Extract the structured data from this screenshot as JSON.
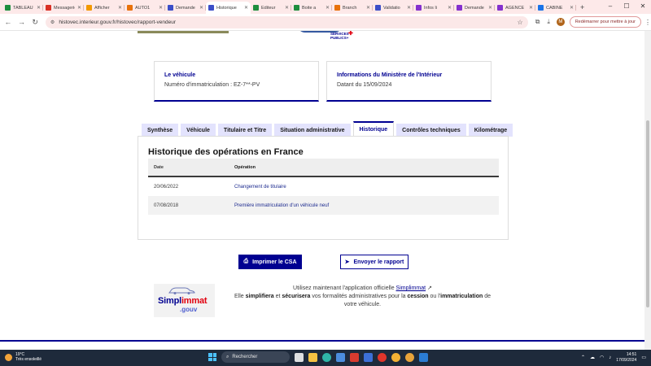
{
  "browser": {
    "tabs": [
      {
        "label": "TABLEAU",
        "color": "#1e8e3e",
        "active": false
      },
      {
        "label": "Messagerie",
        "color": "#d93025",
        "active": false
      },
      {
        "label": "Afficher",
        "color": "#f29900",
        "active": false
      },
      {
        "label": "AUTO1",
        "color": "#e8710a",
        "active": false
      },
      {
        "label": "Demande",
        "color": "#3c4ec8",
        "active": false
      },
      {
        "label": "Historique",
        "color": "#3c4ec8",
        "active": true
      },
      {
        "label": "Editeur",
        "color": "#1e8e3e",
        "active": false
      },
      {
        "label": "Boite a",
        "color": "#1e8e3e",
        "active": false
      },
      {
        "label": "Branch",
        "color": "#e8710a",
        "active": false
      },
      {
        "label": "Validatio",
        "color": "#3c4ec8",
        "active": false
      },
      {
        "label": "Infos li",
        "color": "#8430ce",
        "active": false
      },
      {
        "label": "Demande",
        "color": "#8430ce",
        "active": false
      },
      {
        "label": "AGENCE",
        "color": "#8430ce",
        "active": false
      },
      {
        "label": "CABINE",
        "color": "#1a73e8",
        "active": false
      }
    ],
    "url": "histovec.interieur.gouv.fr/histovec/rapport-vendeur",
    "restart_label": "Redémarrer pour mettre à jour",
    "avatar_letter": "M"
  },
  "header": {
    "service_logo_text": "SERVICES PUBLICS+"
  },
  "cards": [
    {
      "title": "Le véhicule",
      "value": "Numéro d'immatriculation : EZ-7**-PV"
    },
    {
      "title": "Informations du Ministère de l'Intérieur",
      "value": "Datant du 15/09/2024"
    }
  ],
  "report_tabs": [
    {
      "label": "Synthèse",
      "active": false
    },
    {
      "label": "Véhicule",
      "active": false
    },
    {
      "label": "Titulaire et Titre",
      "active": false
    },
    {
      "label": "Situation administrative",
      "active": false
    },
    {
      "label": "Historique",
      "active": true
    },
    {
      "label": "Contrôles techniques",
      "active": false
    },
    {
      "label": "Kilométrage",
      "active": false
    }
  ],
  "history": {
    "title": "Historique des opérations en France",
    "columns": [
      "Date",
      "Opération"
    ],
    "rows": [
      {
        "date": "20/06/2022",
        "operation": "Changement de titulaire"
      },
      {
        "date": "07/08/2018",
        "operation": "Première immatriculation d'un véhicule neuf"
      }
    ]
  },
  "actions": {
    "print_label": "Imprimer le CSA",
    "send_label": "Envoyer le rapport"
  },
  "promo": {
    "logo_word_a": "Simpl",
    "logo_word_b": "immat",
    "logo_suffix": ".gouv",
    "line1_prefix": "Utilisez maintenant l'application officielle ",
    "app_link": "Simplimmat",
    "line2_a": "Elle ",
    "line2_b": "simplifiera",
    "line2_c": " et ",
    "line2_d": "sécurisera",
    "line2_e": " vos formalités administratives pour la ",
    "line2_f": "cession",
    "line2_g": " ou l'",
    "line2_h": "immatriculation",
    "line2_i": " de votre véhicule."
  },
  "taskbar": {
    "temperature": "19°C",
    "weather": "Très ensoleillé",
    "search_placeholder": "Rechercher",
    "time": "14:51",
    "date": "17/09/2024"
  }
}
